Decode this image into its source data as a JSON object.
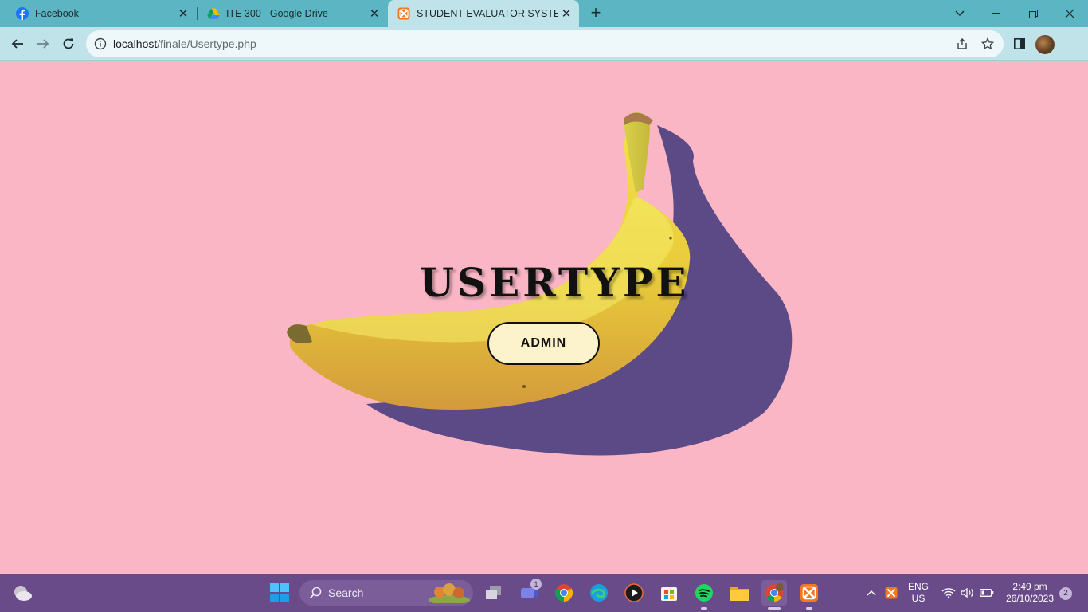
{
  "browser": {
    "tabs": [
      {
        "title": "Facebook",
        "icon": "facebook-icon"
      },
      {
        "title": "ITE 300 - Google Drive",
        "icon": "google-drive-icon"
      },
      {
        "title": "STUDENT EVALUATOR SYSTEM",
        "icon": "xampp-icon",
        "active": true
      }
    ],
    "address": {
      "host": "localhost",
      "path": "/finale/Usertype.php"
    }
  },
  "page": {
    "heading": "USERTYPE",
    "admin_button": "ADMIN",
    "background_color": "#fab6c5"
  },
  "taskbar": {
    "search_label": "Search",
    "teams_badge": "1",
    "language": "ENG",
    "region": "US",
    "time": "2:49 pm",
    "date": "26/10/2023",
    "notifications": "2"
  }
}
